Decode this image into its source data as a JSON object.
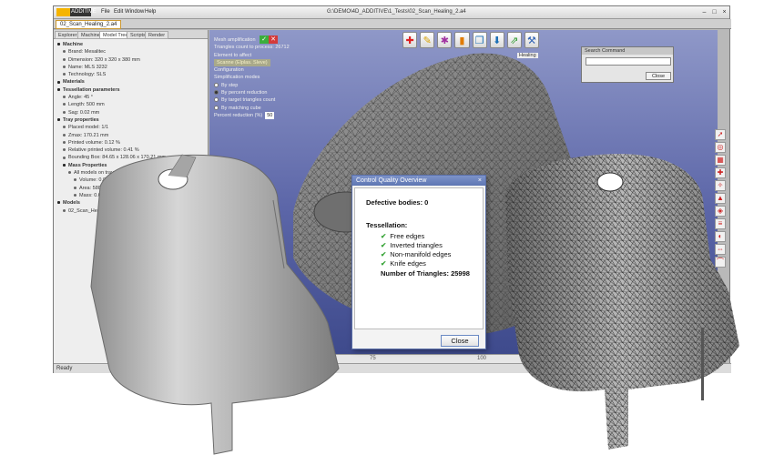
{
  "app": {
    "logo_text": "ADDITIVE",
    "menu": [
      "File",
      "Edit",
      "Window",
      "Help"
    ],
    "window_title": "G:\\DEMO\\4D_ADDITIVE\\1_Tests\\02_Scan_Healing_2.a4",
    "file_tab": "02_Scan_Healing_2.a4"
  },
  "left_panel": {
    "tabs": [
      "Explorer",
      "Machine",
      "Model Tree",
      "Scripts",
      "Render"
    ],
    "active_tab": "Model Tree",
    "tree": [
      {
        "label": "Machine",
        "level": 0,
        "folder": true
      },
      {
        "label": "Brand: Mesalitec",
        "level": 1
      },
      {
        "label": "Dimension: 320 x 320 x 380 mm",
        "level": 1
      },
      {
        "label": "Name: MLS 3232",
        "level": 1
      },
      {
        "label": "Technology: SLS",
        "level": 1
      },
      {
        "label": "Materials",
        "level": 0,
        "folder": true
      },
      {
        "label": "Tessellation parameters",
        "level": 0,
        "folder": true
      },
      {
        "label": "Angle: 45 °",
        "level": 1
      },
      {
        "label": "Length: 500 mm",
        "level": 1
      },
      {
        "label": "Sag: 0.02 mm",
        "level": 1
      },
      {
        "label": "Tray properties",
        "level": 0,
        "folder": true
      },
      {
        "label": "Placed model: 1/1",
        "level": 1
      },
      {
        "label": "Zmax: 170.21 mm",
        "level": 1
      },
      {
        "label": "Printed volume: 0.12 %",
        "level": 1
      },
      {
        "label": "Relative printed volume: 0.41 %",
        "level": 1
      },
      {
        "label": "Bounding Box: 84.65 x 128.06 x 170.21 mm",
        "level": 1
      },
      {
        "label": "Mass Properties",
        "level": 1,
        "folder": true
      },
      {
        "label": "All models on tray",
        "level": 2
      },
      {
        "label": "Volume: 0.047 dm³",
        "level": 3
      },
      {
        "label": "Area: 580.54 cm²",
        "level": 3
      },
      {
        "label": "Mass: 0.047 kg",
        "level": 3
      },
      {
        "label": "Models",
        "level": 0,
        "folder": true
      },
      {
        "label": "02_Scan_Healing",
        "level": 1
      }
    ]
  },
  "mesh_panel": {
    "title": "Mesh amplification",
    "triangles_count": "Triangles count to process: 26712",
    "element_label": "Element to affect",
    "element_value": "Scanne (Elplas. Sleve)",
    "configuration": "Configuration",
    "simplification_modes": "Simplification modes",
    "options": [
      "By step",
      "By percent reduction",
      "By target triangles count",
      "By matching cube"
    ],
    "selected_option": 1,
    "percent_label": "Percent reduction (%)",
    "percent_value": "50"
  },
  "toolbar": {
    "tools": [
      "red-cross-tool",
      "wand-tool",
      "star-tool",
      "bar-chart-tool",
      "copy-tool",
      "download-tool",
      "export-tool",
      "hammer-tool"
    ],
    "healing_label": "Healing"
  },
  "search_panel": {
    "title": "Search Command",
    "input_value": "",
    "close_label": "Close"
  },
  "dialog": {
    "title": "Control Quality Overview",
    "defective_bodies": "Defective bodies: 0",
    "tessellation_heading": "Tessellation:",
    "checks": [
      "Free edges",
      "Inverted triangles",
      "Non-manifold edges",
      "Knife edges"
    ],
    "triangles": "Number of Triangles: 25998",
    "close_label": "Close"
  },
  "ruler": {
    "labels": [
      "75",
      "100"
    ]
  },
  "status": {
    "text": "Ready"
  },
  "colors": {
    "viewport_top": "#8f98c8",
    "viewport_bottom": "#3e4a8c",
    "dialog_title": "#5e76b3",
    "check": "#3aa53a",
    "accent": "#f5b400"
  }
}
